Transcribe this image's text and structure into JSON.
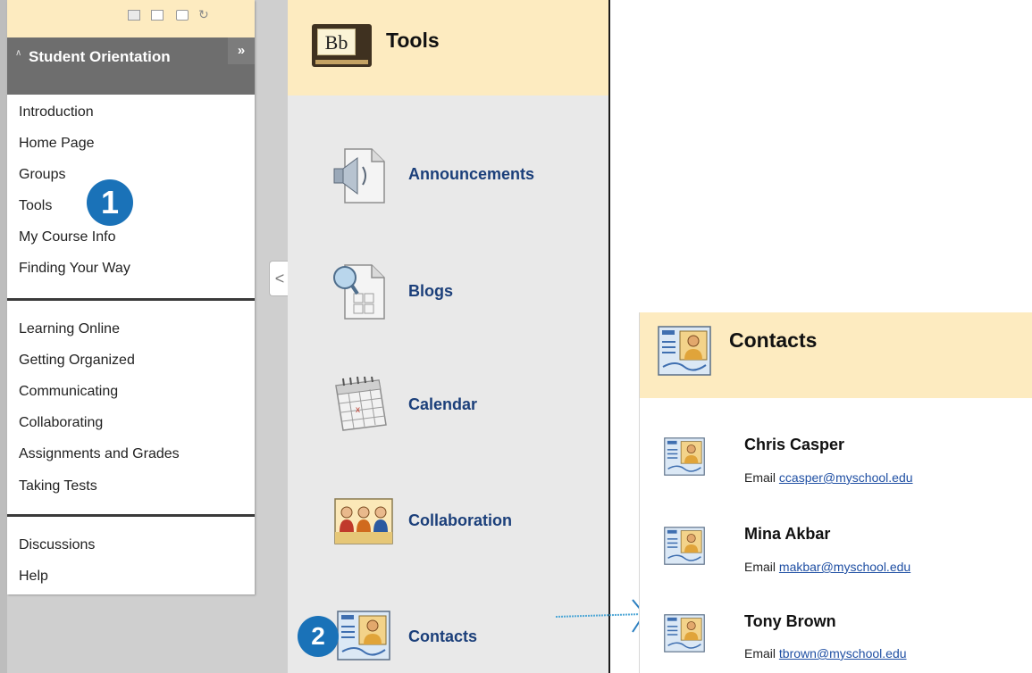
{
  "course_menu": {
    "title": "Student Orientation",
    "expand_glyph": "»",
    "collapse_glyph": "≈",
    "sections": [
      {
        "items": [
          "Introduction",
          "Home Page",
          "Groups",
          "Tools",
          "My Course Info",
          "Finding Your Way"
        ]
      },
      {
        "items": [
          "Learning Online",
          "Getting Organized",
          "Communicating",
          "Collaborating",
          "Assignments and Grades",
          "Taking Tests"
        ]
      },
      {
        "items": [
          "Discussions",
          "Help"
        ]
      }
    ],
    "collapse_arrow": "<"
  },
  "callouts": {
    "step1": "1",
    "step2": "2"
  },
  "tools_page": {
    "title": "Tools",
    "logo_text": "Bb",
    "tools": [
      {
        "label": "Announcements",
        "icon": "speaker-icon"
      },
      {
        "label": "Blogs",
        "icon": "blog-magnifier-icon"
      },
      {
        "label": "Calendar",
        "icon": "calendar-icon"
      },
      {
        "label": "Collaboration",
        "icon": "people-icon"
      },
      {
        "label": "Contacts",
        "icon": "contact-card-icon"
      }
    ]
  },
  "contacts_page": {
    "title": "Contacts",
    "contacts": [
      {
        "name": "Chris Casper",
        "email_label": "Email",
        "email": "ccasper@myschool.edu"
      },
      {
        "name": "Mina Akbar",
        "email_label": "Email",
        "email": "makbar@myschool.edu"
      },
      {
        "name": "Tony Brown",
        "email_label": "Email",
        "email": "tbrown@myschool.edu"
      }
    ]
  },
  "colors": {
    "header_bg": "#fdebc0",
    "menu_header_bg": "#6e6e6e",
    "callout_blue": "#1a72b8",
    "tool_label": "#1b3f7a",
    "link": "#1f4fa3"
  }
}
